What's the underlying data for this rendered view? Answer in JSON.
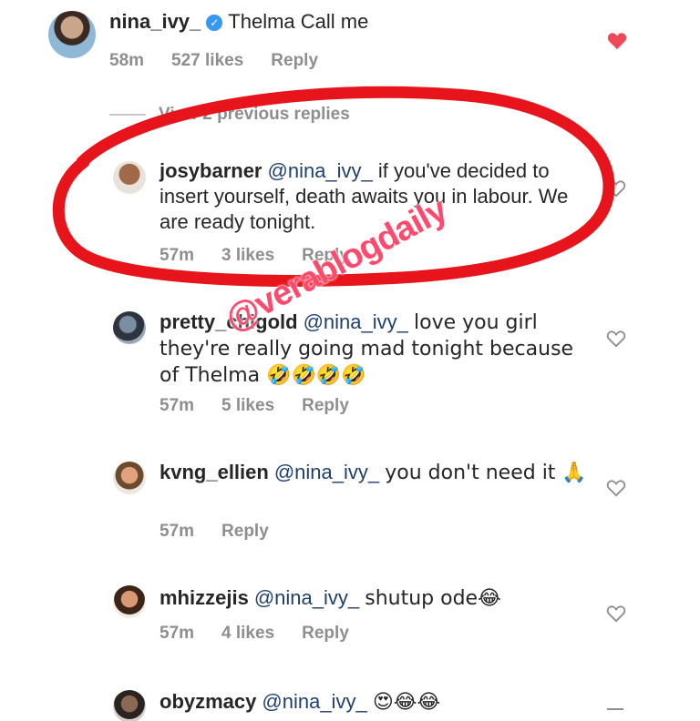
{
  "top_comment": {
    "username": "nina_ivy_",
    "verified": true,
    "text": "Thelma Call me",
    "time": "58m",
    "likes": "527 likes",
    "reply": "Reply",
    "liked": true,
    "heart_color": "#ed4956"
  },
  "view_replies": "View 2 previous replies",
  "replies": [
    {
      "username": "josybarner",
      "mention": "@nina_ivy_",
      "text": "if you've decided to insert yourself, death awaits you in labour. We are ready tonight.",
      "time": "57m",
      "likes": "3 likes",
      "reply": "Reply"
    },
    {
      "username": "pretty_chigold",
      "mention": "@nina_ivy_",
      "text": "love you girl they're really going mad tonight because of Thelma 🤣🤣🤣🤣",
      "time": "57m",
      "likes": "5 likes",
      "reply": "Reply"
    },
    {
      "username": "kvng_ellien",
      "mention": "@nina_ivy_",
      "text": "you don't need it 🙏",
      "time": "57m",
      "likes": "",
      "reply": "Reply"
    },
    {
      "username": "mhizzejis",
      "mention": "@nina_ivy_",
      "text": "shutup ode😂",
      "time": "57m",
      "likes": "4 likes",
      "reply": "Reply"
    },
    {
      "username": "obyzmacy",
      "mention": "@nina_ivy_",
      "text": "😍😂😂"
    }
  ],
  "watermark": "@verablogdaily",
  "colors": {
    "annotation_red": "#e8141b",
    "meta_gray": "#8e8e8e"
  }
}
